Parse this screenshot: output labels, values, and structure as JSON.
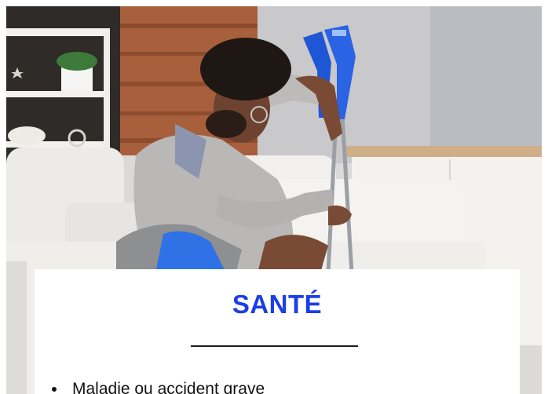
{
  "section": {
    "title": "SANTÉ",
    "accent_color": "#1d3ee6",
    "items": [
      "Maladie ou accident grave"
    ]
  },
  "photo": {
    "icon": "person-with-crutches-photo"
  }
}
